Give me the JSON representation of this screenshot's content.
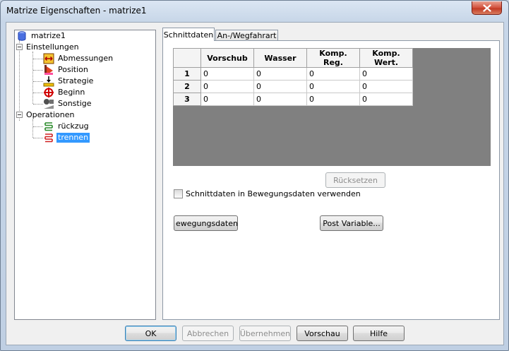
{
  "window": {
    "title": "Matrize Eigenschaften - matrize1"
  },
  "tree": {
    "root": "matrize1",
    "groups": [
      {
        "label": "Einstellungen",
        "items": [
          "Abmessungen",
          "Position",
          "Strategie",
          "Beginn",
          "Sonstige"
        ]
      },
      {
        "label": "Operationen",
        "items": [
          "rückzug",
          "trennen"
        ]
      }
    ],
    "selected": "trennen"
  },
  "tabs": [
    "Schnittdaten",
    "An-/Wegfahrart"
  ],
  "active_tab": "Schnittdaten",
  "grid": {
    "columns": [
      "Vorschub",
      "Wasser",
      "Komp. Reg.",
      "Komp. Wert."
    ],
    "rows": [
      {
        "label": "1",
        "values": [
          "0",
          "0",
          "0",
          "0"
        ]
      },
      {
        "label": "2",
        "values": [
          "0",
          "0",
          "0",
          "0"
        ]
      },
      {
        "label": "3",
        "values": [
          "0",
          "0",
          "0",
          "0"
        ]
      }
    ]
  },
  "panel": {
    "reset_label": "Rücksetzen",
    "checkbox_label": "Schnittdaten in Bewegungsdaten verwenden",
    "checkbox_checked": false,
    "bewegungsdaten_label": "ewegungsdaten..",
    "post_variable_label": "Post Variable..."
  },
  "footer": {
    "ok": "OK",
    "abbrechen": "Abbrechen",
    "uebernehmen": "Übernehmen",
    "vorschau": "Vorschau",
    "hilfe": "Hilfe"
  },
  "colors": {
    "selection": "#3399ff",
    "grid_background": "#808080",
    "close_button": "#c94a35"
  }
}
